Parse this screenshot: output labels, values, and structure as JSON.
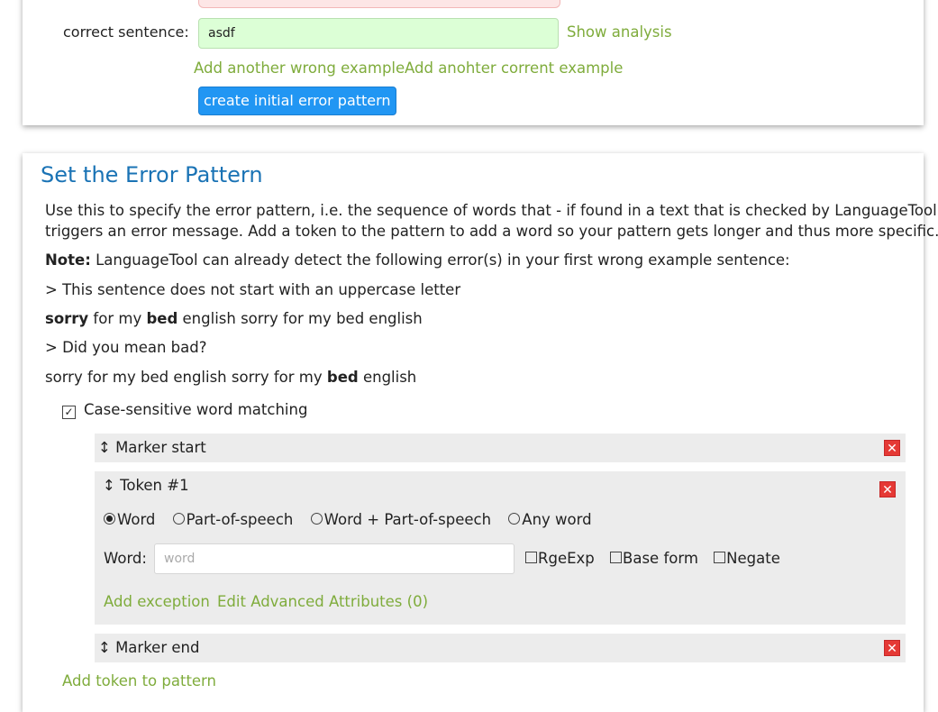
{
  "top": {
    "correct_label": "correct sentence:",
    "correct_value": "asdf",
    "show_analysis": "Show analysis",
    "add_wrong": "Add another wrong example",
    "add_correct": "Add anohter corrent example",
    "create_button": "create initial error pattern"
  },
  "main": {
    "title": "Set the Error Pattern",
    "desc_line1": "Use this to specify the error pattern, i.e. the sequence of words that - if found in a text that is checked by LanguageTool -",
    "desc_line2": "triggers an error message. Add a token to the pattern to add a word so your pattern gets longer and thus more specific.",
    "note_label": "Note:",
    "note_text": " LanguageTool can already detect the following error(s) in your first wrong example sentence:",
    "errors": [
      {
        "message": "> This sentence does not start with an uppercase letter",
        "s1": "sorry",
        "s2": " for my ",
        "s3": "bed",
        "s4": " english sorry for my bed english"
      },
      {
        "message": "> Did you mean bad?",
        "s1": "sorry for my bed english sorry for my ",
        "s2": "bed",
        "s3": " english"
      }
    ],
    "case_sensitive": "Case-sensitive word matching",
    "marker_start": "↕ Marker start",
    "token_title": "↕ Token #1",
    "radios": [
      "Word",
      "Part-of-speech",
      "Word + Part-of-speech",
      "Any word"
    ],
    "word_label": "Word:",
    "word_placeholder": "word",
    "options": [
      "RgeExp",
      "Base form",
      "Negate"
    ],
    "add_exception": "Add exception",
    "edit_advanced": "Edit Advanced Attributes (0)",
    "marker_end": "↕ Marker end",
    "add_token": "Add token to pattern"
  },
  "colors": {
    "link": "#7fac3c",
    "title": "#1a73b5",
    "button": "#2196f3",
    "delete": "#e53935"
  },
  "icons": {
    "delete": "close-icon",
    "drag": "drag-handle-icon"
  }
}
